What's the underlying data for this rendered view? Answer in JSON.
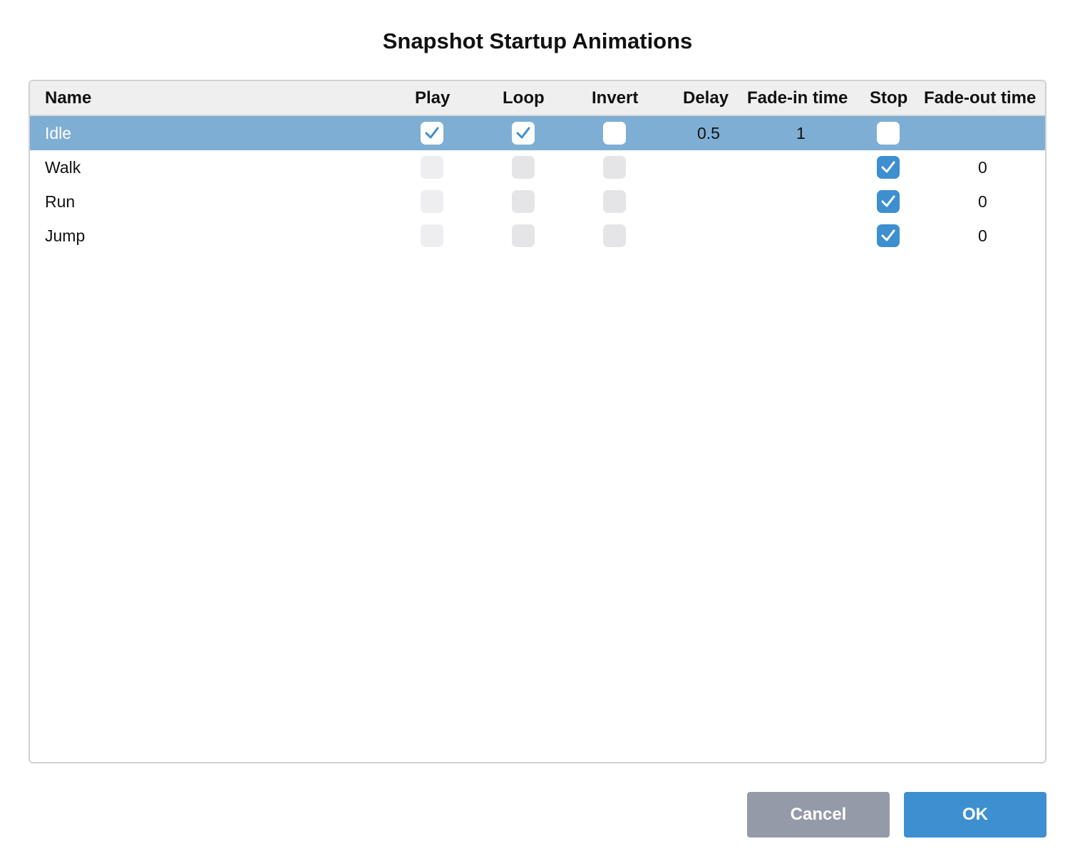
{
  "dialog": {
    "title": "Snapshot Startup Animations"
  },
  "table": {
    "columns": {
      "name": "Name",
      "play": "Play",
      "loop": "Loop",
      "invert": "Invert",
      "delay": "Delay",
      "fade_in": "Fade-in time",
      "stop": "Stop",
      "fade_out": "Fade-out time"
    },
    "rows": [
      {
        "name": "Idle",
        "play": true,
        "loop": true,
        "invert": false,
        "delay": "0.5",
        "fade_in": "1",
        "stop": false,
        "fade_out": "",
        "selected": true
      },
      {
        "name": "Walk",
        "play": false,
        "loop": false,
        "invert": false,
        "delay": "",
        "fade_in": "",
        "stop": true,
        "fade_out": "0",
        "selected": false
      },
      {
        "name": "Run",
        "play": false,
        "loop": false,
        "invert": false,
        "delay": "",
        "fade_in": "",
        "stop": true,
        "fade_out": "0",
        "selected": false
      },
      {
        "name": "Jump",
        "play": false,
        "loop": false,
        "invert": false,
        "delay": "",
        "fade_in": "",
        "stop": true,
        "fade_out": "0",
        "selected": false
      }
    ]
  },
  "buttons": {
    "cancel": "Cancel",
    "ok": "OK"
  },
  "colors": {
    "selected_row": "#7eaed3",
    "accent": "#3d8fd0",
    "cancel_button": "#949aa8",
    "header_bg": "#efefef"
  }
}
